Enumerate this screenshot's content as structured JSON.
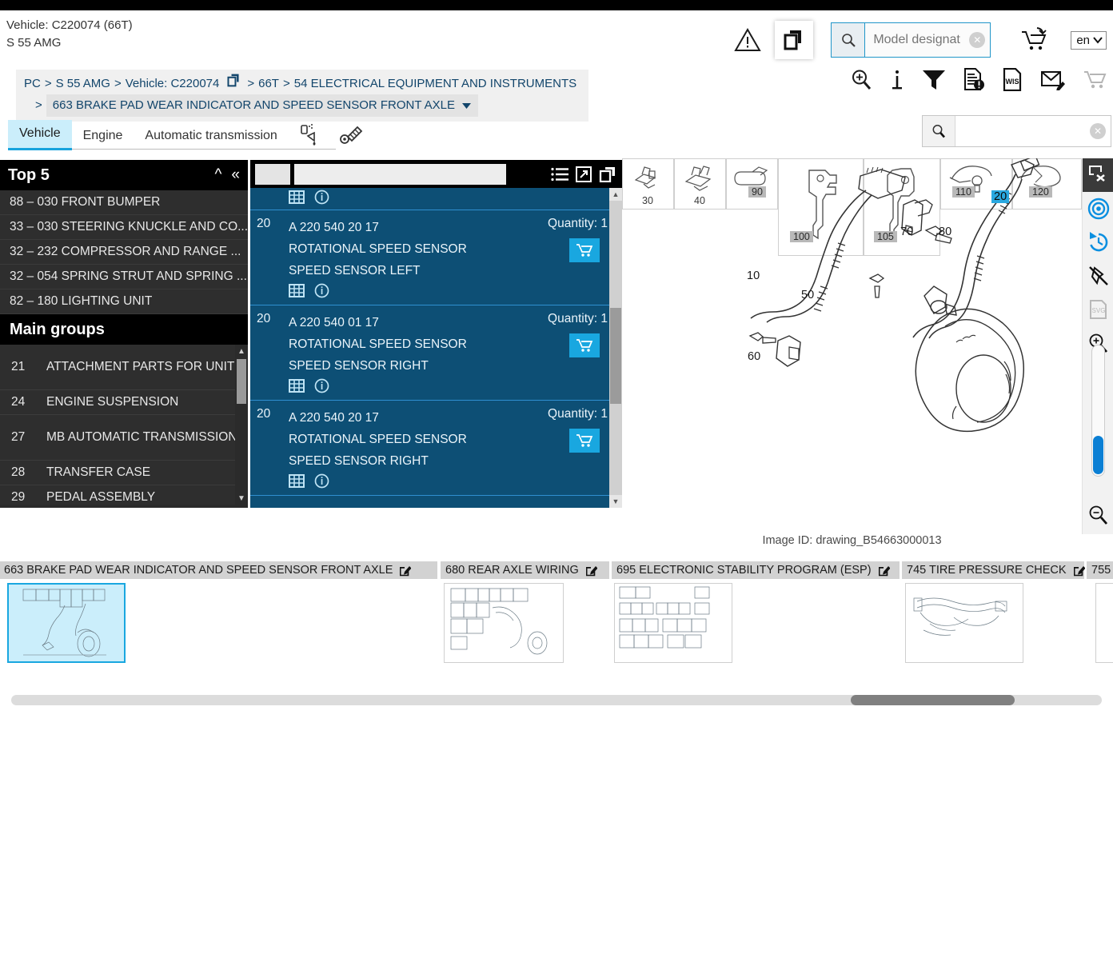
{
  "header": {
    "vehicle_line1": "Vehicle: C220074 (66T)",
    "vehicle_line2": "S 55 AMG",
    "search_placeholder": "Model designat",
    "language": "en",
    "icons": {
      "warning": "warning-icon",
      "copy": "copy-icon",
      "search": "search-icon",
      "clear": "clear-icon",
      "cart": "cart-add-icon",
      "chevron": "chevron-down-icon"
    }
  },
  "breadcrumb": {
    "items": [
      "PC",
      "S 55 AMG",
      "Vehicle: C220074",
      "66T",
      "54 ELECTRICAL EQUIPMENT AND INSTRUMENTS"
    ],
    "current": "663 BRAKE PAD WEAR INDICATOR AND SPEED SENSOR FRONT AXLE",
    "separator": ">"
  },
  "toolbar": {
    "icons": [
      {
        "name": "zoom-search-icon",
        "label": "Zoom search"
      },
      {
        "name": "info-icon",
        "label": "Information"
      },
      {
        "name": "filter-icon",
        "label": "Filter"
      },
      {
        "name": "document-alert-icon",
        "label": "Document notes"
      },
      {
        "name": "wis-icon",
        "label": "WIS"
      },
      {
        "name": "mail-edit-icon",
        "label": "Mail"
      },
      {
        "name": "cart-icon",
        "label": "Shopping cart"
      }
    ]
  },
  "tabs": {
    "items": [
      {
        "label": "Vehicle",
        "active": true
      },
      {
        "label": "Engine",
        "active": false
      },
      {
        "label": "Automatic transmission",
        "active": false
      }
    ],
    "icon_tabs": [
      "paint-spray-icon",
      "tools-bolt-icon"
    ],
    "search_value": ""
  },
  "sidebar": {
    "top5_title": "Top 5",
    "collapse_icon": "chevron-up-icon",
    "collapse_all_icon": "double-chevron-left-icon",
    "top5": [
      "88 – 030 FRONT BUMPER",
      "33 – 030 STEERING KNUCKLE AND CO...",
      "32 – 232 COMPRESSOR AND RANGE ...",
      "32 – 054 SPRING STRUT AND SPRING ...",
      "82 – 180 LIGHTING UNIT"
    ],
    "main_groups_title": "Main groups",
    "main_groups": [
      {
        "num": "21",
        "label": "ATTACHMENT PARTS FOR UNITS"
      },
      {
        "num": "24",
        "label": "ENGINE SUSPENSION"
      },
      {
        "num": "27",
        "label": "MB AUTOMATIC TRANSMISSION"
      },
      {
        "num": "28",
        "label": "TRANSFER CASE"
      },
      {
        "num": "29",
        "label": "PEDAL ASSEMBLY"
      }
    ]
  },
  "parts": {
    "header_icons": [
      "list-view-icon",
      "expand-icon",
      "copy-icon"
    ],
    "filter_value": "",
    "quantity_label": "Quantity:",
    "rows": [
      {
        "pos": "20",
        "part_number": "A 220 540 20  17",
        "name": "ROTATIONAL SPEED SENSOR",
        "desc": "SPEED SENSOR LEFT",
        "quantity": "1"
      },
      {
        "pos": "20",
        "part_number": "A 220 540 01  17",
        "name": "ROTATIONAL SPEED SENSOR",
        "desc": "SPEED SENSOR RIGHT",
        "quantity": "1"
      },
      {
        "pos": "20",
        "part_number": "A 220 540 20  17",
        "name": "ROTATIONAL SPEED SENSOR",
        "desc": "SPEED SENSOR RIGHT",
        "quantity": "1"
      }
    ],
    "row_icons": [
      "table-icon",
      "info-circle-icon"
    ],
    "add_to_cart_icon": "cart-icon"
  },
  "viewer": {
    "image_id": "Image ID: drawing_B54663000013",
    "thumbnail_numbers": [
      "30",
      "40",
      "90",
      "100",
      "105",
      "110",
      "120"
    ],
    "callouts": [
      "10",
      "20",
      "50",
      "60",
      "70",
      "80"
    ],
    "highlighted_callout": "20",
    "vertical_tools": [
      {
        "name": "close-window-icon"
      },
      {
        "name": "target-focus-icon"
      },
      {
        "name": "history-undo-icon"
      },
      {
        "name": "unpin-icon"
      },
      {
        "name": "svg-icon"
      },
      {
        "name": "zoom-in-icon"
      },
      {
        "name": "zoom-slider"
      },
      {
        "name": "zoom-out-icon"
      }
    ]
  },
  "bottom": {
    "tabs": [
      {
        "label": "663 BRAKE PAD WEAR INDICATOR AND SPEED SENSOR FRONT AXLE",
        "selected": true
      },
      {
        "label": "680 REAR AXLE WIRING",
        "selected": false
      },
      {
        "label": "695 ELECTRONIC STABILITY PROGRAM (ESP)",
        "selected": false
      },
      {
        "label": "745 TIRE PRESSURE CHECK",
        "selected": false
      },
      {
        "label": "755",
        "selected": false
      }
    ],
    "edit_icon": "edit-pencil-icon"
  },
  "colors": {
    "accent_blue": "#19a7e0",
    "panel_blue": "#0d4f75",
    "tab_active": "#cbeefb",
    "breadcrumb_text": "#12456b"
  }
}
